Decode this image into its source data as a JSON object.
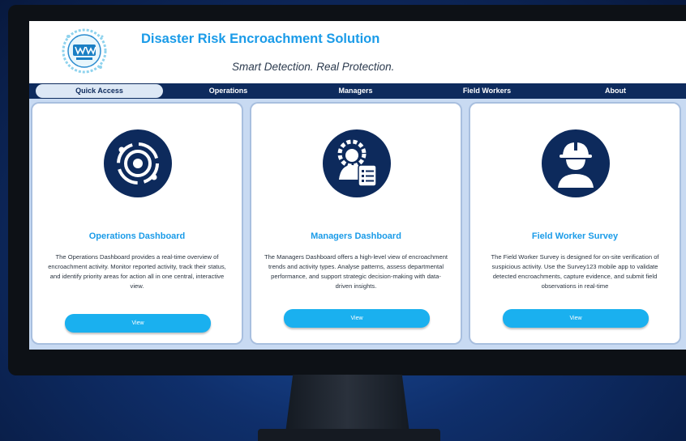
{
  "app": {
    "title": "Disaster Risk Encroachment Solution",
    "tagline": "Smart Detection. Real Protection."
  },
  "nav": {
    "items": [
      {
        "label": "Quick Access",
        "active": true
      },
      {
        "label": "Operations",
        "active": false
      },
      {
        "label": "Managers",
        "active": false
      },
      {
        "label": "Field Workers",
        "active": false
      },
      {
        "label": "About",
        "active": false
      }
    ]
  },
  "cards": [
    {
      "icon": "operations-dashboard-icon",
      "title": "Operations Dashboard",
      "description": "The Operations Dashboard provides a real-time overview of encroachment activity. Monitor reported activity, track their status, and identify priority areas for action all in one central, interactive view.",
      "button_label": "View"
    },
    {
      "icon": "manager-checklist-icon",
      "title": "Managers Dashboard",
      "description": "The Managers Dashboard offers a high-level view of encroachment trends and activity types. Analyse patterns, assess departmental performance, and support strategic decision-making with data-driven insights.",
      "button_label": "View"
    },
    {
      "icon": "field-worker-helmet-icon",
      "title": "Field Worker Survey",
      "description": "The Field Worker Survey is designed for on-site verification of suspicious activity. Use the Survey123 mobile app to validate detected encroachments, capture evidence, and submit field observations in real-time",
      "button_label": "View"
    }
  ],
  "colors": {
    "brand_blue": "#1a9be8",
    "nav_navy": "#0e2b5d",
    "button_cyan": "#1ab0ef",
    "icon_navy": "#0d2a5c"
  }
}
